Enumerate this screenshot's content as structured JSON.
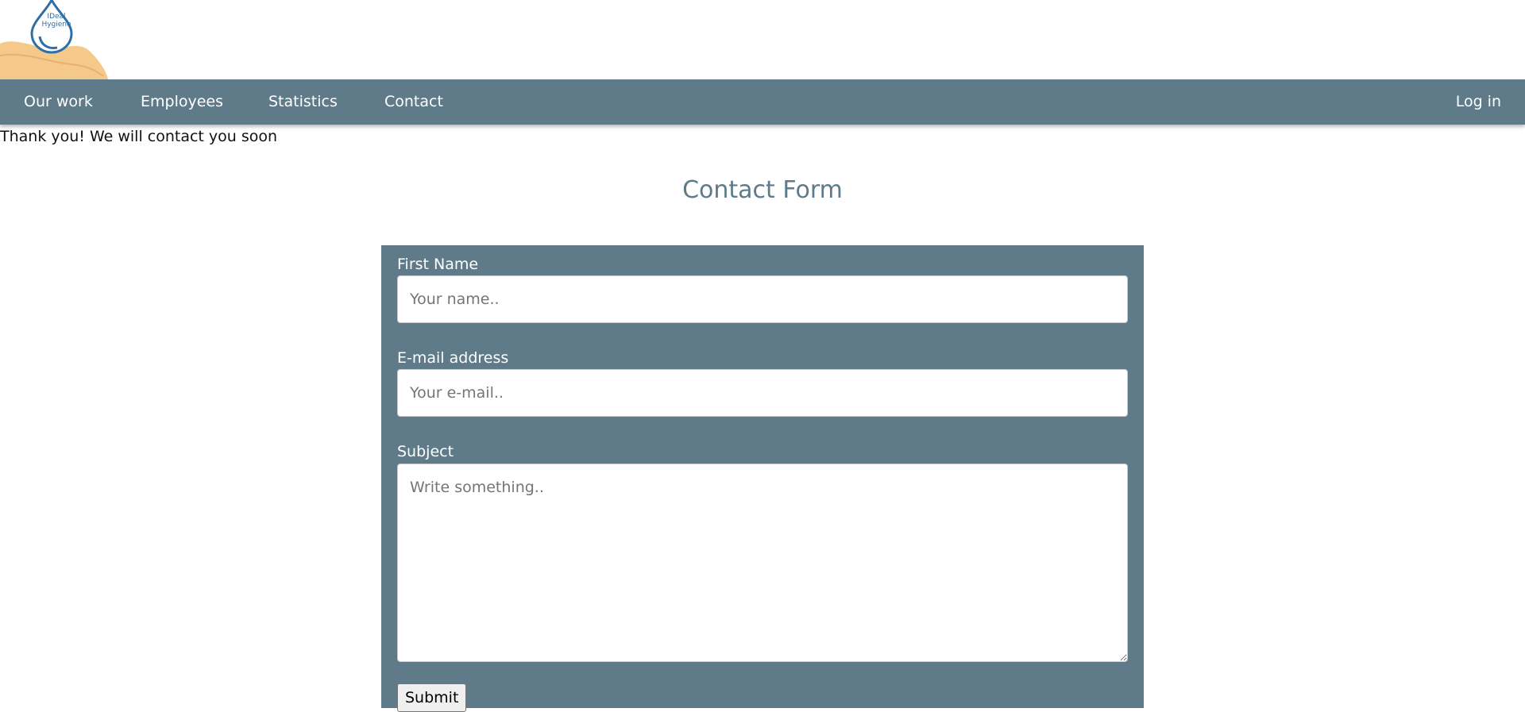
{
  "brand": {
    "logo_text_line1": "IDeal",
    "logo_text_line2": "Hygiene"
  },
  "nav": {
    "items": [
      {
        "label": "Our work"
      },
      {
        "label": "Employees"
      },
      {
        "label": "Statistics"
      },
      {
        "label": "Contact"
      }
    ],
    "login_label": "Log in"
  },
  "status": {
    "message": "Thank you! We will contact you soon"
  },
  "form": {
    "title": "Contact Form",
    "first_name_label": "First Name",
    "first_name_placeholder": "Your name..",
    "first_name_value": "",
    "email_label": "E-mail address",
    "email_placeholder": "Your e-mail..",
    "email_value": "",
    "subject_label": "Subject",
    "subject_placeholder": "Write something..",
    "subject_value": "",
    "submit_label": "Submit"
  },
  "colors": {
    "nav_background": "#5f7b89",
    "form_background": "#5f7b89",
    "title_color": "#5f7b89"
  }
}
